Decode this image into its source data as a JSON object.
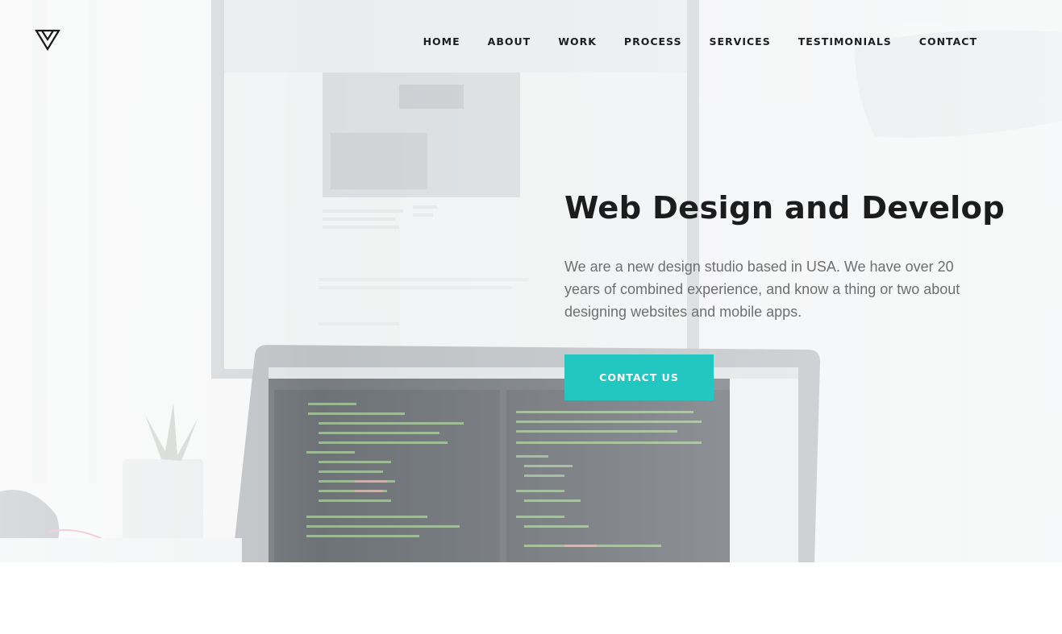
{
  "brand": {
    "logo_icon": "triangle-logo-icon"
  },
  "nav": {
    "items": [
      {
        "label": "HOME"
      },
      {
        "label": "ABOUT"
      },
      {
        "label": "WORK"
      },
      {
        "label": "PROCESS"
      },
      {
        "label": "SERVICES"
      },
      {
        "label": "TESTIMONIALS"
      },
      {
        "label": "CONTACT"
      }
    ]
  },
  "hero": {
    "title": "Web Design and Develop",
    "text": "We are a new design studio based in USA. We have over 20 years of combined experience, and know a thing or two about designing websites and mobile apps.",
    "cta_label": "CONTACT US",
    "background_image": "desk-with-monitor-and-laptop-code"
  },
  "colors": {
    "accent": "#21c7c0",
    "title": "#1c1c1c",
    "text": "#6f6f6f",
    "nav": "#1e1e1e"
  }
}
